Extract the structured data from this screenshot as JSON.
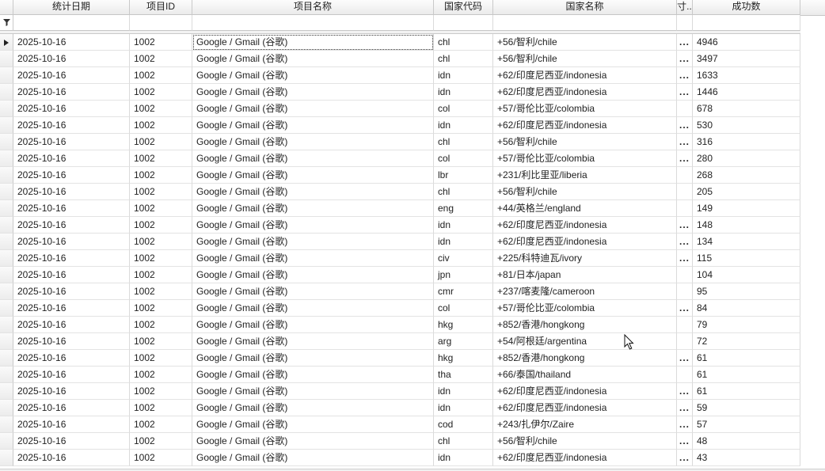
{
  "columns": {
    "date": "统计日期",
    "project_id": "项目ID",
    "project_name": "项目名称",
    "country_code": "国家代码",
    "country_name": "国家名称",
    "truncated": "寸..",
    "success_count": "成功数"
  },
  "filter_icon": "funnel-icon",
  "current_row_icon": "triangle-right-icon",
  "rows": [
    {
      "date": "2025-10-16",
      "project_id": "1002",
      "project_name": "Google / Gmail (谷歌)",
      "country_code": "chl",
      "country_name": "+56/智利/chile",
      "truncated": "...",
      "success_count": "4946"
    },
    {
      "date": "2025-10-16",
      "project_id": "1002",
      "project_name": "Google / Gmail (谷歌)",
      "country_code": "chl",
      "country_name": "+56/智利/chile",
      "truncated": "...",
      "success_count": "3497"
    },
    {
      "date": "2025-10-16",
      "project_id": "1002",
      "project_name": "Google / Gmail (谷歌)",
      "country_code": "idn",
      "country_name": "+62/印度尼西亚/indonesia",
      "truncated": "...",
      "success_count": "1633"
    },
    {
      "date": "2025-10-16",
      "project_id": "1002",
      "project_name": "Google / Gmail (谷歌)",
      "country_code": "idn",
      "country_name": "+62/印度尼西亚/indonesia",
      "truncated": "...",
      "success_count": "1446"
    },
    {
      "date": "2025-10-16",
      "project_id": "1002",
      "project_name": "Google / Gmail (谷歌)",
      "country_code": "col",
      "country_name": "+57/哥伦比亚/colombia",
      "truncated": "",
      "success_count": "678"
    },
    {
      "date": "2025-10-16",
      "project_id": "1002",
      "project_name": "Google / Gmail (谷歌)",
      "country_code": "idn",
      "country_name": "+62/印度尼西亚/indonesia",
      "truncated": "...",
      "success_count": "530"
    },
    {
      "date": "2025-10-16",
      "project_id": "1002",
      "project_name": "Google / Gmail (谷歌)",
      "country_code": "chl",
      "country_name": "+56/智利/chile",
      "truncated": "...",
      "success_count": "316"
    },
    {
      "date": "2025-10-16",
      "project_id": "1002",
      "project_name": "Google / Gmail (谷歌)",
      "country_code": "col",
      "country_name": "+57/哥伦比亚/colombia",
      "truncated": "...",
      "success_count": "280"
    },
    {
      "date": "2025-10-16",
      "project_id": "1002",
      "project_name": "Google / Gmail (谷歌)",
      "country_code": "lbr",
      "country_name": "+231/利比里亚/liberia",
      "truncated": "",
      "success_count": "268"
    },
    {
      "date": "2025-10-16",
      "project_id": "1002",
      "project_name": "Google / Gmail (谷歌)",
      "country_code": "chl",
      "country_name": "+56/智利/chile",
      "truncated": "",
      "success_count": "205"
    },
    {
      "date": "2025-10-16",
      "project_id": "1002",
      "project_name": "Google / Gmail (谷歌)",
      "country_code": "eng",
      "country_name": "+44/英格兰/england",
      "truncated": "",
      "success_count": "149"
    },
    {
      "date": "2025-10-16",
      "project_id": "1002",
      "project_name": "Google / Gmail (谷歌)",
      "country_code": "idn",
      "country_name": "+62/印度尼西亚/indonesia",
      "truncated": "...",
      "success_count": "148"
    },
    {
      "date": "2025-10-16",
      "project_id": "1002",
      "project_name": "Google / Gmail (谷歌)",
      "country_code": "idn",
      "country_name": "+62/印度尼西亚/indonesia",
      "truncated": "...",
      "success_count": "134"
    },
    {
      "date": "2025-10-16",
      "project_id": "1002",
      "project_name": "Google / Gmail (谷歌)",
      "country_code": "civ",
      "country_name": "+225/科特迪瓦/ivory",
      "truncated": "...",
      "success_count": "115"
    },
    {
      "date": "2025-10-16",
      "project_id": "1002",
      "project_name": "Google / Gmail (谷歌)",
      "country_code": "jpn",
      "country_name": "+81/日本/japan",
      "truncated": "",
      "success_count": "104"
    },
    {
      "date": "2025-10-16",
      "project_id": "1002",
      "project_name": "Google / Gmail (谷歌)",
      "country_code": "cmr",
      "country_name": "+237/喀麦隆/cameroon",
      "truncated": "",
      "success_count": "95"
    },
    {
      "date": "2025-10-16",
      "project_id": "1002",
      "project_name": "Google / Gmail (谷歌)",
      "country_code": "col",
      "country_name": "+57/哥伦比亚/colombia",
      "truncated": "...",
      "success_count": "84"
    },
    {
      "date": "2025-10-16",
      "project_id": "1002",
      "project_name": "Google / Gmail (谷歌)",
      "country_code": "hkg",
      "country_name": "+852/香港/hongkong",
      "truncated": "",
      "success_count": "79"
    },
    {
      "date": "2025-10-16",
      "project_id": "1002",
      "project_name": "Google / Gmail (谷歌)",
      "country_code": "arg",
      "country_name": "+54/阿根廷/argentina",
      "truncated": "",
      "success_count": "72"
    },
    {
      "date": "2025-10-16",
      "project_id": "1002",
      "project_name": "Google / Gmail (谷歌)",
      "country_code": "hkg",
      "country_name": "+852/香港/hongkong",
      "truncated": "...",
      "success_count": "61"
    },
    {
      "date": "2025-10-16",
      "project_id": "1002",
      "project_name": "Google / Gmail (谷歌)",
      "country_code": "tha",
      "country_name": "+66/泰国/thailand",
      "truncated": "",
      "success_count": "61"
    },
    {
      "date": "2025-10-16",
      "project_id": "1002",
      "project_name": "Google / Gmail (谷歌)",
      "country_code": "idn",
      "country_name": "+62/印度尼西亚/indonesia",
      "truncated": "...",
      "success_count": "61"
    },
    {
      "date": "2025-10-16",
      "project_id": "1002",
      "project_name": "Google / Gmail (谷歌)",
      "country_code": "idn",
      "country_name": "+62/印度尼西亚/indonesia",
      "truncated": "...",
      "success_count": "59"
    },
    {
      "date": "2025-10-16",
      "project_id": "1002",
      "project_name": "Google / Gmail (谷歌)",
      "country_code": "cod",
      "country_name": "+243/扎伊尔/Zaire",
      "truncated": "...",
      "success_count": "57"
    },
    {
      "date": "2025-10-16",
      "project_id": "1002",
      "project_name": "Google / Gmail (谷歌)",
      "country_code": "chl",
      "country_name": "+56/智利/chile",
      "truncated": "...",
      "success_count": "48"
    },
    {
      "date": "2025-10-16",
      "project_id": "1002",
      "project_name": "Google / Gmail (谷歌)",
      "country_code": "idn",
      "country_name": "+62/印度尼西亚/indonesia",
      "truncated": "...",
      "success_count": "43"
    }
  ]
}
